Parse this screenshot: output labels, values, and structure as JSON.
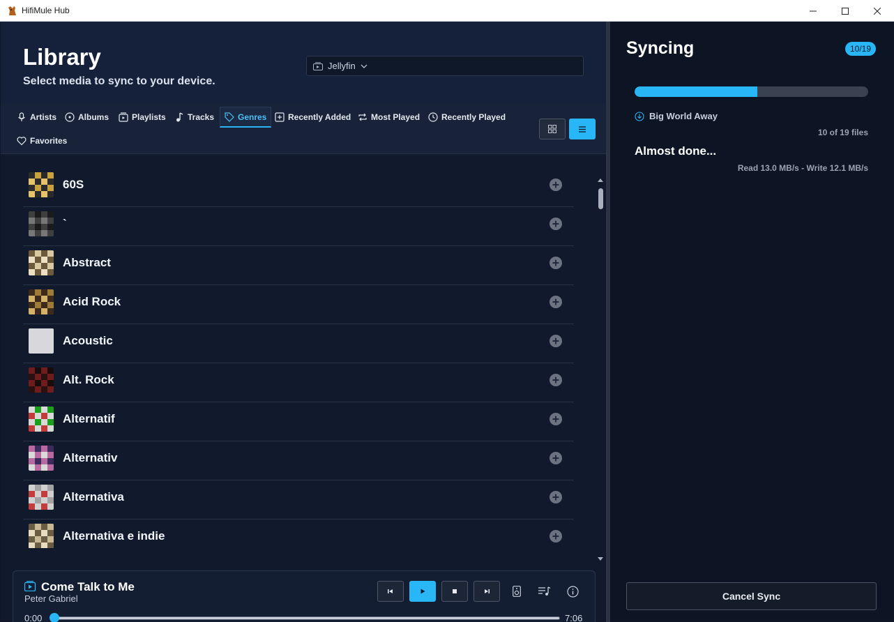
{
  "window": {
    "title": "HifiMule Hub",
    "controls": [
      "minimize",
      "maximize",
      "close"
    ]
  },
  "library": {
    "title": "Library",
    "subtitle": "Select media to sync to your device.",
    "source": {
      "label": "Jellyfin",
      "icon": "media-server-icon"
    }
  },
  "tabs": [
    {
      "label": "Artists",
      "icon": "microphone-icon",
      "active": false
    },
    {
      "label": "Albums",
      "icon": "album-icon",
      "active": false
    },
    {
      "label": "Playlists",
      "icon": "playlist-icon",
      "active": false
    },
    {
      "label": "Tracks",
      "icon": "music-note-icon",
      "active": false
    },
    {
      "label": "Genres",
      "icon": "tag-icon",
      "active": true
    },
    {
      "label": "Recently Added",
      "icon": "plus-box-icon",
      "active": false
    },
    {
      "label": "Most Played",
      "icon": "repeat-icon",
      "active": false
    },
    {
      "label": "Recently Played",
      "icon": "history-icon",
      "active": false
    },
    {
      "label": "Favorites",
      "icon": "heart-icon",
      "active": false
    }
  ],
  "view_modes": {
    "grid": "grid-view",
    "list": "list-view",
    "selected": "list-view"
  },
  "genres": [
    {
      "label": "60S",
      "thumb": [
        "#c9a23d",
        "#2b2b2b",
        "#e6c26a"
      ]
    },
    {
      "label": "`",
      "thumb": [
        "#1b1b1b",
        "#3f3f3f",
        "#777777"
      ]
    },
    {
      "label": "Abstract",
      "thumb": [
        "#d8c9a3",
        "#6d5a3a",
        "#ede0c2"
      ]
    },
    {
      "label": "Acid Rock",
      "thumb": [
        "#9c7c36",
        "#3d2a1a",
        "#d4b267"
      ]
    },
    {
      "label": "Acoustic",
      "thumb": [
        "#d8d8dc",
        "#d8d8dc",
        "#d8d8dc"
      ]
    },
    {
      "label": "Alt. Rock",
      "thumb": [
        "#1a0c0c",
        "#6e1c1c",
        "#2b1010"
      ]
    },
    {
      "label": "Alternatif",
      "thumb": [
        "#1ba01b",
        "#d8d8d8",
        "#c23a3a"
      ]
    },
    {
      "label": "Alternativ",
      "thumb": [
        "#3c2b5c",
        "#b86aa0",
        "#d9d9d9"
      ]
    },
    {
      "label": "Alternativa",
      "thumb": [
        "#a3a3a3",
        "#d0d0d0",
        "#c43d3d"
      ]
    },
    {
      "label": "Alternativa e indie",
      "thumb": [
        "#c9b896",
        "#6a5d44",
        "#e8dcc0"
      ]
    }
  ],
  "player": {
    "title": "Come Talk to Me",
    "artist": "Peter Gabriel",
    "time_elapsed": "0:00",
    "time_total": "7:06",
    "progress": 0.0,
    "controls": [
      "previous",
      "play",
      "stop",
      "next"
    ],
    "extra": [
      "speaker-icon",
      "queue-icon",
      "info-icon"
    ]
  },
  "sync": {
    "title": "Syncing",
    "badge": "10/19",
    "progress": 0.5263,
    "current_file": "Big World Away",
    "files_count": "10 of 19 files",
    "status": "Almost done...",
    "rates": "Read 13.0 MB/s - Write 12.1 MB/s",
    "cancel_label": "Cancel Sync"
  },
  "colors": {
    "accent": "#29b6f6",
    "background": "#111a2d",
    "panel": "#0d1525"
  }
}
